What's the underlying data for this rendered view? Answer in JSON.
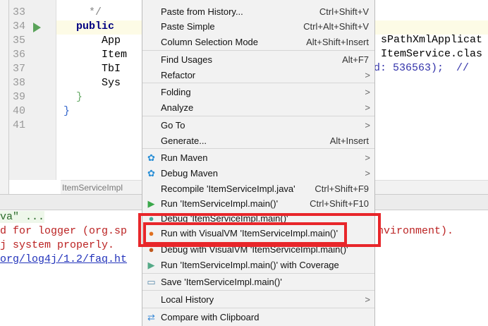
{
  "editor": {
    "line_numbers": [
      "33",
      "34",
      "35",
      "36",
      "37",
      "38",
      "39",
      "40",
      "41"
    ],
    "lines": [
      "    */",
      "  public ",
      "      App",
      "      Item",
      "      TbI",
      "      Sys",
      "  }",
      "}",
      ""
    ],
    "right_fragments": [
      "sPathXmlApplicat",
      "ItemService.clas",
      "d: 536563);  //"
    ],
    "breadcrumb": "ItemServiceImpl"
  },
  "console": {
    "lines": [
      "va\" ...",
      "d for logger (org.sp",
      "j system properly.",
      "org/log4j/1.2/faq.ht"
    ],
    "right_fragment": "nvironment)."
  },
  "menu": {
    "items": [
      {
        "label": "Paste from History...",
        "shortcut": "Ctrl+Shift+V"
      },
      {
        "label": "Paste Simple",
        "shortcut": "Ctrl+Alt+Shift+V"
      },
      {
        "label": "Column Selection Mode",
        "shortcut": "Alt+Shift+Insert"
      },
      {
        "label": "Find Usages",
        "shortcut": "Alt+F7"
      },
      {
        "label": "Refactor",
        "shortcut": ">"
      },
      {
        "label": "Folding",
        "shortcut": ">"
      },
      {
        "label": "Analyze",
        "shortcut": ">"
      },
      {
        "label": "Go To",
        "shortcut": ">"
      },
      {
        "label": "Generate...",
        "shortcut": "Alt+Insert"
      },
      {
        "label": "Run Maven",
        "shortcut": ">",
        "icon": "gear-icon"
      },
      {
        "label": "Debug Maven",
        "shortcut": ">",
        "icon": "gear-icon"
      },
      {
        "label": "Recompile 'ItemServiceImpl.java'",
        "shortcut": "Ctrl+Shift+F9"
      },
      {
        "label": "Run 'ItemServiceImpl.main()'",
        "shortcut": "Ctrl+Shift+F10",
        "icon": "run-icon"
      },
      {
        "label": "Debug 'ItemServiceImpl.main()'",
        "shortcut": "",
        "icon": "debug-icon"
      },
      {
        "label": "Run with VisualVM 'ItemServiceImpl.main()'",
        "shortcut": "",
        "icon": "visualvm-run-icon"
      },
      {
        "label": "Debug with VisualVM 'ItemServiceImpl.main()'",
        "shortcut": "",
        "icon": "visualvm-debug-icon"
      },
      {
        "label": "Run 'ItemServiceImpl.main()' with Coverage",
        "shortcut": "",
        "icon": "coverage-icon"
      },
      {
        "label": "Save 'ItemServiceImpl.main()'",
        "shortcut": "",
        "icon": "save-icon"
      },
      {
        "label": "Local History",
        "shortcut": ">"
      },
      {
        "label": "Compare with Clipboard",
        "shortcut": "",
        "icon": "compare-icon"
      }
    ]
  },
  "colors": {
    "highlight": "#e8262a",
    "keyword": "#000080",
    "number": "#0000ff"
  }
}
